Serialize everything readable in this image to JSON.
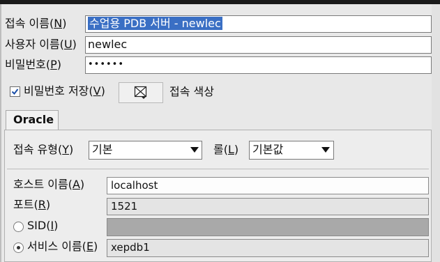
{
  "connection": {
    "name_label": "접속 이름(",
    "name_mnemonic": "N",
    "name_value": "수업용 PDB 서버 - newlec",
    "user_label": "사용자 이름(",
    "user_mnemonic": "U",
    "user_value": "newlec",
    "password_label": "비밀번호(",
    "password_mnemonic": "P",
    "password_value": "••••••",
    "save_password_label": "비밀번호 저장(",
    "save_password_mnemonic": "V",
    "save_password_checked": true,
    "color_label": "접속 색상"
  },
  "tabs": {
    "oracle": "Oracle"
  },
  "oracle": {
    "conn_type_label": "접속 유형(",
    "conn_type_mnemonic": "Y",
    "conn_type_value": "기본",
    "role_label": "롤(",
    "role_mnemonic": "L",
    "role_value": "기본값",
    "host_label": "호스트 이름(",
    "host_mnemonic": "A",
    "host_value": "localhost",
    "port_label": "포트(",
    "port_mnemonic": "R",
    "port_value": "1521",
    "sid_label": "SID(",
    "sid_mnemonic": "I",
    "sid_value": "",
    "service_label": "서비스 이름(",
    "service_mnemonic": "E",
    "service_value": "xepdb1",
    "selected_radio": "service"
  }
}
